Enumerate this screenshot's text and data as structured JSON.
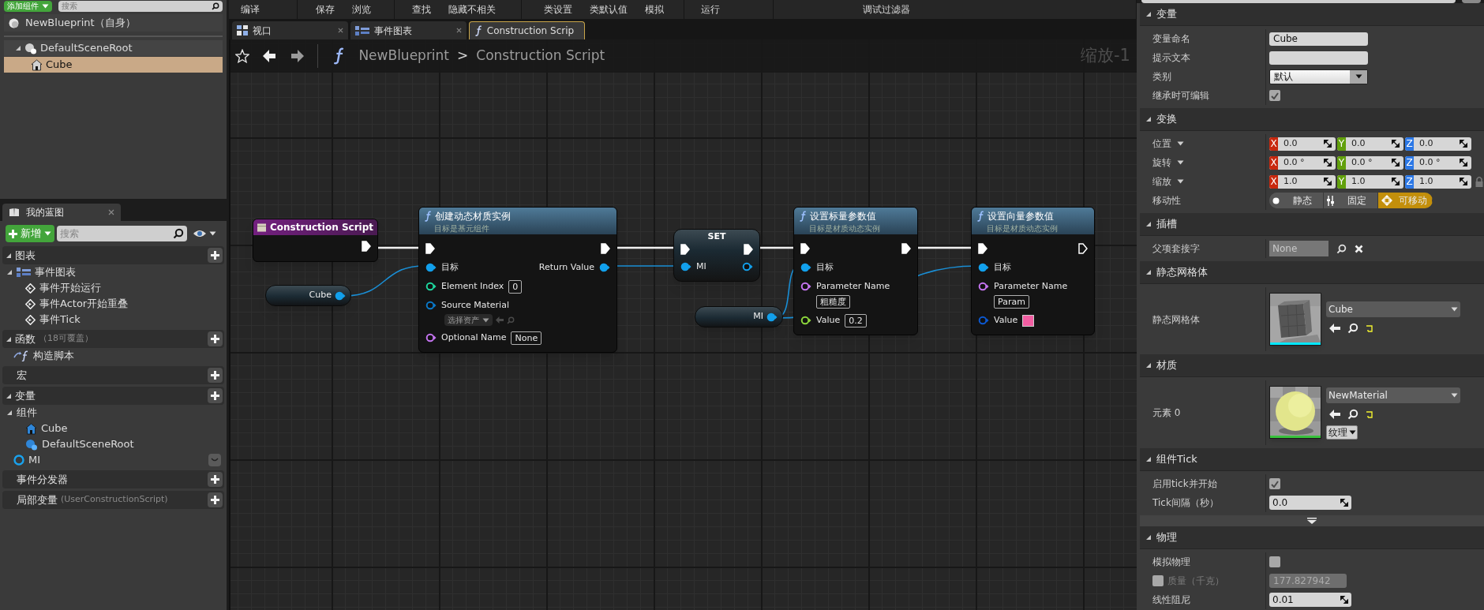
{
  "toolbar": {
    "groups": [
      [
        "编译"
      ],
      [
        "保存",
        "浏览"
      ],
      [
        "查找",
        "隐藏不相关"
      ],
      [
        "类设置",
        "类默认值",
        "模拟"
      ],
      [
        "运行"
      ],
      [
        "调试过滤器"
      ]
    ]
  },
  "components": {
    "add_button": "添加组件",
    "search": {
      "placeholder": "搜索"
    },
    "root": "NewBlueprint（自身）",
    "tree": [
      {
        "label": "DefaultSceneRoot",
        "kind": "scene",
        "expanded": true,
        "selected": false,
        "children": [
          {
            "label": "Cube",
            "kind": "mesh",
            "selected": true
          }
        ]
      }
    ]
  },
  "my_blueprint": {
    "tab": "我的蓝图",
    "add_button": "新增",
    "search": {
      "placeholder": "搜索"
    },
    "sections": [
      {
        "title": "图表",
        "expanded": true,
        "items": [
          {
            "label": "事件图表",
            "kind": "graph",
            "expanded": true,
            "children": [
              {
                "label": "事件开始运行",
                "kind": "event"
              },
              {
                "label": "事件Actor开始重叠",
                "kind": "event"
              },
              {
                "label": "事件Tick",
                "kind": "event"
              }
            ]
          }
        ]
      },
      {
        "title": "函数",
        "note": "（18可覆盖）",
        "expanded": true,
        "items": [
          {
            "label": "构造脚本",
            "kind": "function"
          }
        ]
      },
      {
        "title": "宏"
      },
      {
        "title": "变量",
        "expanded": true,
        "items": [
          {
            "label": "组件",
            "kind": "category",
            "expanded": true,
            "children": [
              {
                "label": "Cube",
                "kind": "mesh"
              },
              {
                "label": "DefaultSceneRoot",
                "kind": "scene"
              }
            ]
          },
          {
            "label": "MI",
            "kind": "variable"
          }
        ]
      },
      {
        "title": "事件分发器"
      },
      {
        "title": "局部变量",
        "note": "(UserConstructionScript)"
      }
    ]
  },
  "graph": {
    "tabs": [
      {
        "label": "视口",
        "kind": "viewport",
        "selected": false
      },
      {
        "label": "事件图表",
        "kind": "graph",
        "selected": false
      },
      {
        "label": "Construction Scrip",
        "kind": "function",
        "selected": true
      }
    ],
    "breadcrumb": {
      "blueprint": "NewBlueprint",
      "separator": ">",
      "graph": "Construction Script"
    },
    "zoom": "缩放-1",
    "nodes": [
      {
        "kind": "entry",
        "title": "Construction Script",
        "outputs": [
          {
            "kind": "exec",
            "connected": true
          }
        ]
      },
      {
        "kind": "getter",
        "title": "Cube",
        "outputs": [
          {
            "kind": "object",
            "connected": true
          }
        ]
      },
      {
        "kind": "function",
        "title": "创建动态材质实例",
        "subtitle": "目标是基元组件",
        "inputs": [
          {
            "kind": "exec",
            "connected": true
          },
          {
            "kind": "object",
            "label": "目标",
            "connected": true
          },
          {
            "kind": "int",
            "label": "Element Index",
            "value": "0",
            "connected": false
          },
          {
            "kind": "asset",
            "label": "Source Material",
            "value": "选择资产",
            "connected": false
          },
          {
            "kind": "name",
            "label": "Optional Name",
            "value": "None",
            "connected": false
          }
        ],
        "outputs": [
          {
            "kind": "exec",
            "connected": true
          },
          {
            "kind": "object",
            "label": "Return Value",
            "connected": true
          }
        ]
      },
      {
        "kind": "set",
        "title": "SET",
        "inputs": [
          {
            "kind": "exec",
            "connected": true
          },
          {
            "kind": "object",
            "label": "MI",
            "connected": true
          }
        ],
        "outputs": [
          {
            "kind": "exec",
            "connected": true
          },
          {
            "kind": "object",
            "connected": false
          }
        ]
      },
      {
        "kind": "getter",
        "title": "MI",
        "outputs": [
          {
            "kind": "object",
            "connected": true
          }
        ]
      },
      {
        "kind": "function",
        "title": "设置标量参数值",
        "subtitle": "目标是材质动态实例",
        "inputs": [
          {
            "kind": "exec",
            "connected": true
          },
          {
            "kind": "object",
            "label": "目标",
            "connected": true
          },
          {
            "kind": "name",
            "label": "Parameter Name",
            "value": "粗糙度",
            "connected": false
          },
          {
            "kind": "float",
            "label": "Value",
            "value": "0.2",
            "connected": false
          }
        ],
        "outputs": [
          {
            "kind": "exec",
            "connected": true
          }
        ]
      },
      {
        "kind": "function",
        "title": "设置向量参数值",
        "subtitle": "目标是材质动态实例",
        "inputs": [
          {
            "kind": "exec",
            "connected": true
          },
          {
            "kind": "object",
            "label": "目标",
            "connected": true
          },
          {
            "kind": "name",
            "label": "Parameter Name",
            "value": "Param",
            "connected": false
          },
          {
            "kind": "color",
            "label": "Value",
            "color": "#f25ea2",
            "connected": false
          }
        ],
        "outputs": [
          {
            "kind": "exec",
            "connected": false
          }
        ]
      }
    ]
  },
  "details": {
    "sections": [
      {
        "title": "变量",
        "expanded": true,
        "rows": [
          {
            "label": "变量命名",
            "kind": "text",
            "value": "Cube"
          },
          {
            "label": "提示文本",
            "kind": "text"
          },
          {
            "label": "类别",
            "kind": "dropdown",
            "value": "默认"
          },
          {
            "label": "继承时可编辑",
            "kind": "checkbox",
            "checked": true
          }
        ]
      },
      {
        "title": "变换",
        "expanded": true,
        "rows": [
          {
            "label": "位置",
            "kind": "vector",
            "axes": [
              {
                "axis": "X",
                "value": "0.0",
                "color": "#c8280e"
              },
              {
                "axis": "Y",
                "value": "0.0",
                "color": "#62a00c"
              },
              {
                "axis": "Z",
                "value": "0.0",
                "color": "#2c78e6"
              }
            ]
          },
          {
            "label": "旋转",
            "kind": "vector",
            "axes": [
              {
                "axis": "X",
                "value": "0.0 °",
                "color": "#c8280e"
              },
              {
                "axis": "Y",
                "value": "0.0 °",
                "color": "#62a00c"
              },
              {
                "axis": "Z",
                "value": "0.0 °",
                "color": "#2c78e6"
              }
            ]
          },
          {
            "label": "缩放",
            "kind": "vector",
            "lock": true,
            "axes": [
              {
                "axis": "X",
                "value": "1.0",
                "color": "#c8280e"
              },
              {
                "axis": "Y",
                "value": "1.0",
                "color": "#62a00c"
              },
              {
                "axis": "Z",
                "value": "1.0",
                "color": "#2c78e6"
              }
            ]
          },
          {
            "label": "移动性",
            "kind": "mobility",
            "options": [
              {
                "label": "静态",
                "kind": "static",
                "selected": false
              },
              {
                "label": "固定",
                "kind": "stationary",
                "selected": false
              },
              {
                "label": "可移动",
                "kind": "movable",
                "selected": true
              }
            ]
          }
        ]
      },
      {
        "title": "插槽",
        "expanded": true,
        "rows": [
          {
            "label": "父项套接字",
            "kind": "socket",
            "value": "None"
          }
        ]
      },
      {
        "title": "静态网格体",
        "expanded": true,
        "rows": [
          {
            "label": "静态网格体",
            "kind": "mesh",
            "value": "Cube",
            "color": "#00e8ff"
          }
        ]
      },
      {
        "title": "材质",
        "expanded": true,
        "rows": [
          {
            "label": "元素 0",
            "kind": "material",
            "value": "NewMaterial",
            "color": "#38c23c",
            "button": "纹理"
          }
        ]
      },
      {
        "title": "组件Tick",
        "expanded": true,
        "advanced_expanded": false,
        "rows": [
          {
            "label": "启用tick并开始",
            "kind": "checkbox",
            "checked": true
          },
          {
            "label": "Tick间隔（秒）",
            "kind": "number",
            "value": "0.0"
          }
        ]
      },
      {
        "title": "物理",
        "expanded": true,
        "rows": [
          {
            "label": "模拟物理",
            "kind": "checkbox",
            "checked": false
          },
          {
            "label": "质量（千克）",
            "kind": "number",
            "value": "177.827942",
            "disabled": true,
            "override_checked": false
          },
          {
            "label": "线性阻尼",
            "kind": "number",
            "value": "0.01"
          }
        ]
      }
    ]
  }
}
